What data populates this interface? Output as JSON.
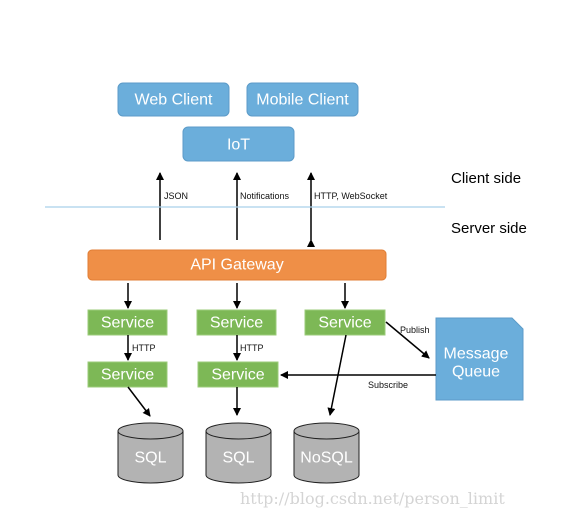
{
  "clients": {
    "web": "Web Client",
    "mobile": "Mobile Client",
    "iot": "IoT"
  },
  "connections": {
    "json": "JSON",
    "notifications": "Notifications",
    "http_websocket": "HTTP, WebSocket"
  },
  "zones": {
    "client_side": "Client side",
    "server_side": "Server side"
  },
  "gateway": "API Gateway",
  "services": [
    "Service",
    "Service",
    "Service",
    "Service",
    "Service"
  ],
  "http_labels": [
    "HTTP",
    "HTTP"
  ],
  "message_queue": {
    "line1": "Message",
    "line2": "Queue",
    "publish": "Publish",
    "subscribe": "Subscribe"
  },
  "databases": [
    "SQL",
    "SQL",
    "NoSQL"
  ],
  "watermark": "http://blog.csdn.net/person_limit",
  "colors": {
    "client": "#6BAEDB",
    "gateway": "#EF8F47",
    "service": "#7DB856",
    "database": "#B3B3B3",
    "divider": "#A9D0EA"
  }
}
